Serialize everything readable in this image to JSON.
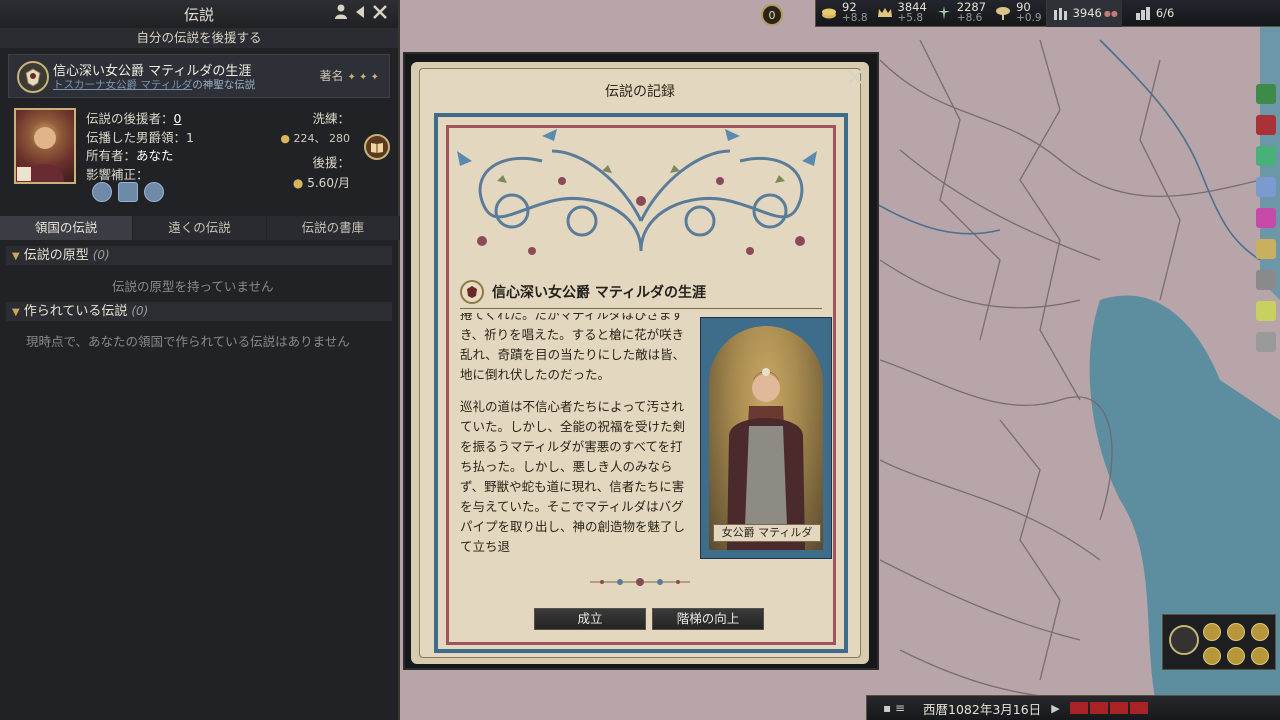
{
  "topbar": {
    "gold": {
      "value": "92",
      "delta": "+8.8",
      "icon": "gold-coins-icon"
    },
    "prestige": {
      "value": "3844",
      "delta": "+5.8",
      "icon": "crown-icon"
    },
    "piety": {
      "value": "2287",
      "delta": "+8.6",
      "icon": "piety-icon"
    },
    "renown": {
      "value": "90",
      "delta": "+0.9",
      "icon": "dynasty-tree-icon"
    },
    "soldiers": {
      "value": "3946",
      "icon": "soldiers-icon"
    },
    "domain": {
      "value": "6/6",
      "icon": "domain-icon"
    },
    "notification_count": "0"
  },
  "left_panel": {
    "title": "伝説",
    "subtitle": "自分の伝説を後援する",
    "legend": {
      "name": "信心深い女公爵 マティルダの生涯",
      "subline_link": "トスカーナ女公爵 マティルダ",
      "subline_rest": "の神聖な伝説",
      "quality_label": "著名",
      "quality_stars": "✦ ✦ ✦"
    },
    "patrons_label": "伝説の後援者：",
    "patrons_value": "0",
    "spread_label": "伝播した男爵領：",
    "spread_value": "1",
    "owner_label": "所有者：",
    "owner_value": "あなた",
    "influence_label": "影響補正：",
    "refine_label": "洗練：",
    "refine_costs": "224、 280",
    "patron_label": "後援：",
    "patron_value": "5.60/月",
    "tabs": [
      "領国の伝説",
      "遠くの伝説",
      "伝説の書庫"
    ],
    "section_seeds": {
      "title": "伝説の原型",
      "count": "(0)",
      "empty": "伝説の原型を持っていません"
    },
    "section_created": {
      "title": "作られている伝説",
      "count": "(0)",
      "empty": "現時点で、あなたの領国で作られている伝説はありません"
    }
  },
  "modal": {
    "title": "伝説の記録",
    "legend_title": "信心深い女公爵 マティルダの生涯",
    "story_p1": "捲てくれた。だがマティルダはひざまずき、祈りを唱えた。すると槍に花が咲き乱れ、奇蹟を目の当たりにした敵は皆、地に倒れ伏したのだった。",
    "story_p2": "巡礼の道は不信心者たちによって汚されていた。しかし、全能の祝福を受けた剣を振るうマティルダが害悪のすべてを打ち払った。しかし、悪しき人のみならず、野獣や蛇も道に現れ、信者たちに害を与えていた。そこでマティルダはバグパイプを取り出し、神の創造物を魅了して立ち退",
    "portrait_caption": "女公爵 マティルダ",
    "btn_form": "成立",
    "btn_tier": "階梯の向上"
  },
  "datebar": {
    "date": "西暦1082年3月16日"
  }
}
